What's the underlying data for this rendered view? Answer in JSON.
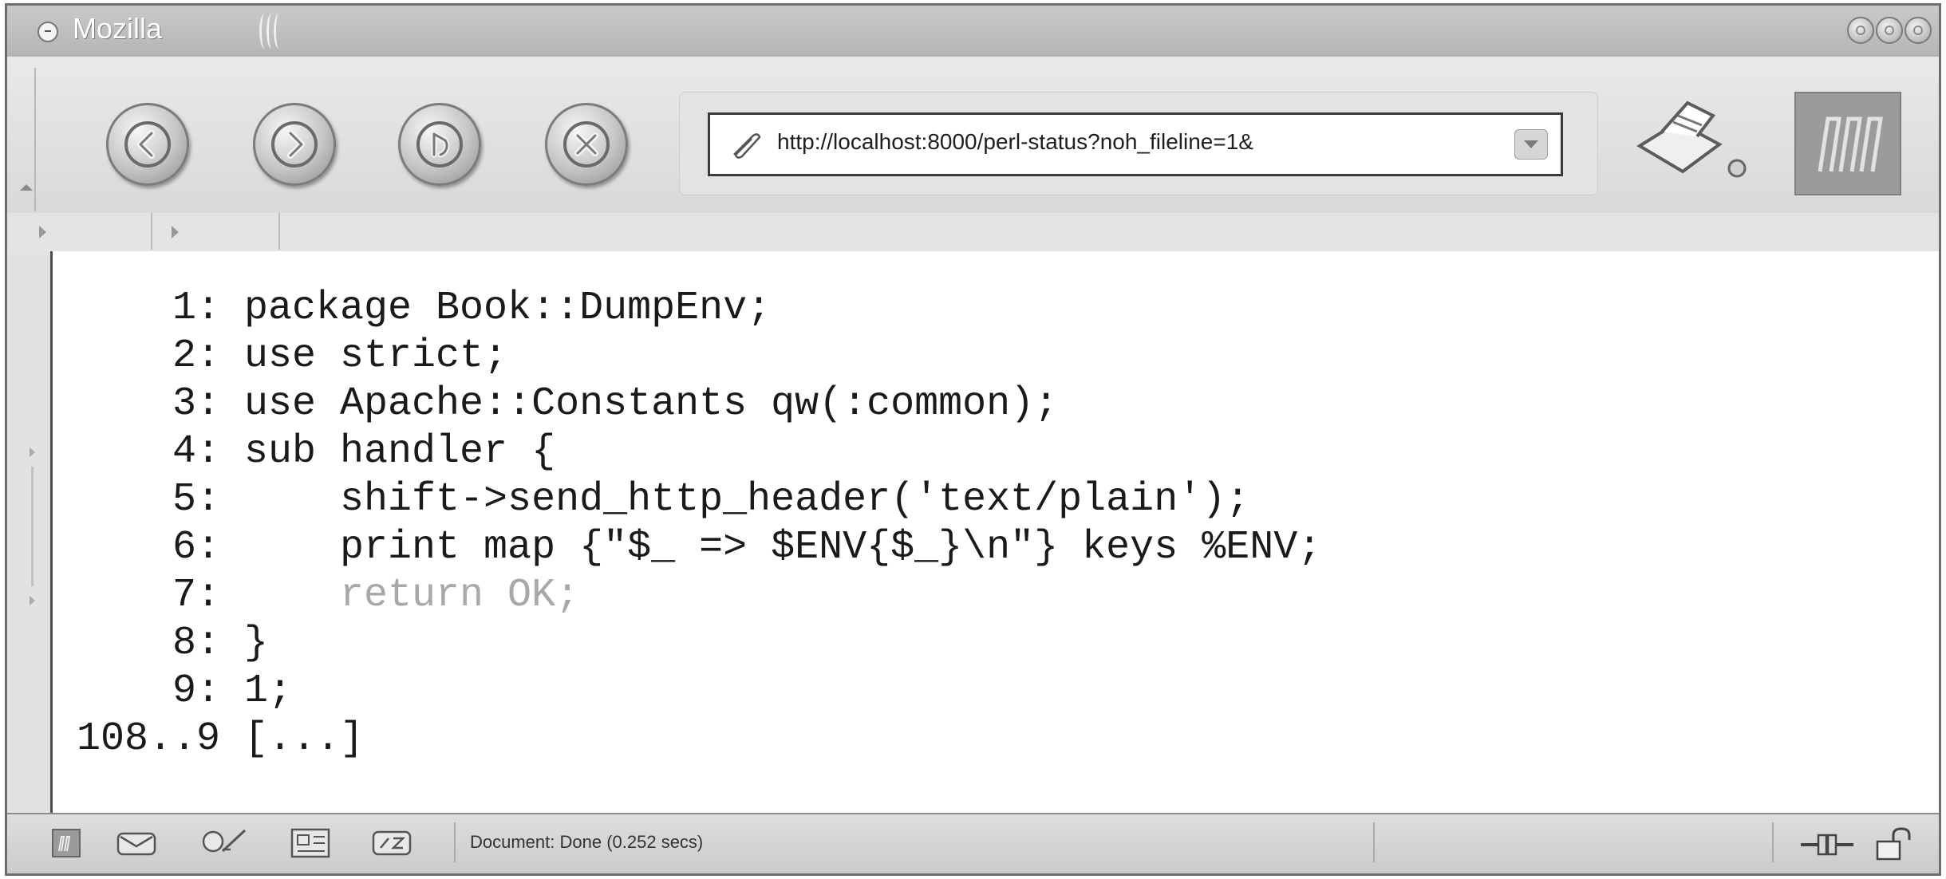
{
  "window": {
    "title": "Mozilla"
  },
  "navigation": {
    "back_icon": "back-arrow-icon",
    "forward_icon": "forward-arrow-icon",
    "reload_icon": "reload-icon",
    "stop_icon": "stop-icon",
    "url": "http://localhost:8000/perl-status?noh_fileline=1&",
    "print_icon": "print-icon",
    "throbber_icon": "mozilla-m-logo"
  },
  "code": {
    "lines": [
      {
        "num": "1:",
        "text": " package Book::DumpEnv;",
        "dim": false
      },
      {
        "num": "2:",
        "text": " use strict;",
        "dim": false
      },
      {
        "num": "3:",
        "text": " use Apache::Constants qw(:common);",
        "dim": false
      },
      {
        "num": "4:",
        "text": " sub handler {",
        "dim": false
      },
      {
        "num": "5:",
        "text": "     shift->send_http_header('text/plain');",
        "dim": false
      },
      {
        "num": "6:",
        "text": "     print map {\"$_ => $ENV{$_}\\n\"} keys %ENV;",
        "dim": false
      },
      {
        "num": "7:",
        "text": "     return OK;",
        "dim": true
      },
      {
        "num": "8:",
        "text": " }",
        "dim": false
      },
      {
        "num": "9:",
        "text": " 1;",
        "dim": false
      },
      {
        "num": "108..9",
        "text": " [...]",
        "dim": false
      }
    ]
  },
  "statusbar": {
    "icons": [
      "navigator-icon",
      "mail-icon",
      "composer-icon",
      "address-book-icon",
      "chat-icon"
    ],
    "status_text": "Document: Done (0.252 secs)",
    "online_icon": "online-status-icon",
    "security_icon": "padlock-icon"
  }
}
